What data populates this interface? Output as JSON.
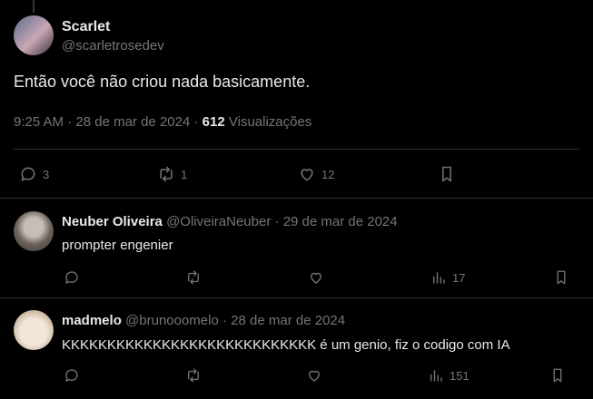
{
  "main_tweet": {
    "author_name": "Scarlet",
    "author_handle": "@scarletrosedev",
    "text": "Então você não criou nada basicamente.",
    "time": "9:25 AM",
    "date": "28 de mar de 2024",
    "views_count": "612",
    "views_label": "Visualizações",
    "replies": "3",
    "retweets": "1",
    "likes": "12"
  },
  "replies": [
    {
      "author_name": "Neuber Oliveira",
      "author_handle": "@OliveiraNeuber",
      "date": "29 de mar de 2024",
      "text": "prompter engenier",
      "views": "17"
    },
    {
      "author_name": "madmelo",
      "author_handle": "@brunooomelo",
      "date": "28 de mar de 2024",
      "text": "KKKKKKKKKKKKKKKKKKKKKKKKKKKK é um genio, fiz o codigo com IA",
      "views": "151"
    }
  ],
  "separator": "·",
  "icons": [
    "reply-icon",
    "retweet-icon",
    "like-icon",
    "views-icon",
    "bookmark-icon"
  ]
}
